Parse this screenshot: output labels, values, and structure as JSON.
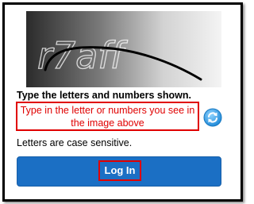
{
  "captcha": {
    "text": "r7aff",
    "image_alt": "captcha-image"
  },
  "form": {
    "instruction": "Type the letters and numbers shown.",
    "callout": "Type in the letter or numbers you see in the image above",
    "case_note": "Letters are case sensitive.",
    "login_label": "Log In",
    "refresh_icon": "refresh-icon"
  },
  "colors": {
    "accent_blue": "#1b6fc4",
    "annotation_red": "#e00000"
  }
}
